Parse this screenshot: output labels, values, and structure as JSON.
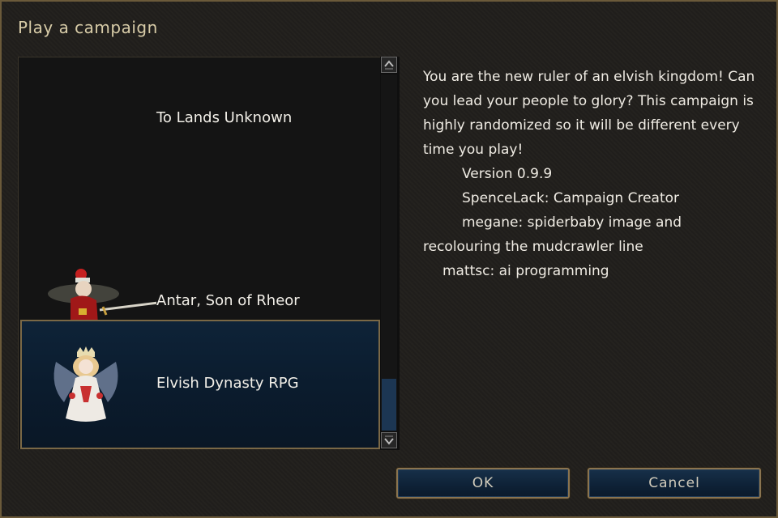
{
  "dialog": {
    "title": "Play a campaign"
  },
  "campaigns": [
    {
      "label": "To Lands Unknown",
      "icon": "none"
    },
    {
      "label": "Antar, Son of Rheor",
      "icon": "swordsman-portrait-icon"
    },
    {
      "label": "Elvish Dynasty RPG",
      "icon": "fairy-queen-portrait-icon",
      "selected": true
    }
  ],
  "description": {
    "lines": [
      "You are the new ruler of an elvish kingdom! Can you lead your people to glory? This campaign is highly randomized so it will be different every time you play!",
      "Version 0.9.9",
      "SpenceLack: Campaign Creator",
      "megane: spiderbaby image and",
      "recolouring the mudcrawler line",
      "mattsc: ai programming"
    ]
  },
  "buttons": {
    "ok": "OK",
    "cancel": "Cancel"
  },
  "scrollbar": {
    "position_fraction": 1.0
  },
  "colors": {
    "selection": "#0e2338",
    "frame_gold": "#8a7450",
    "button_blue": "#173049"
  }
}
